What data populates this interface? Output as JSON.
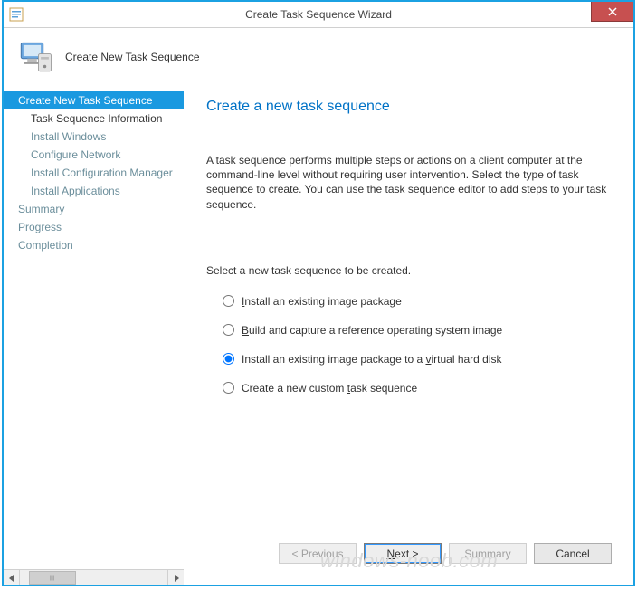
{
  "window": {
    "title": "Create Task Sequence Wizard",
    "close_icon_name": "close-icon"
  },
  "header": {
    "title": "Create New Task Sequence"
  },
  "nav": {
    "items": [
      {
        "label": "Create New Task Sequence",
        "selected": true,
        "indent": false
      },
      {
        "label": "Task Sequence Information",
        "selected": false,
        "indent": true,
        "active": true
      },
      {
        "label": "Install Windows",
        "selected": false,
        "indent": true
      },
      {
        "label": "Configure Network",
        "selected": false,
        "indent": true
      },
      {
        "label": "Install Configuration Manager",
        "selected": false,
        "indent": true
      },
      {
        "label": "Install Applications",
        "selected": false,
        "indent": true
      },
      {
        "label": "Summary",
        "selected": false,
        "indent": false
      },
      {
        "label": "Progress",
        "selected": false,
        "indent": false
      },
      {
        "label": "Completion",
        "selected": false,
        "indent": false
      }
    ]
  },
  "page": {
    "title": "Create a new task sequence",
    "description": "A task sequence performs multiple steps or actions on a client computer at the command-line level without requiring user intervention. Select the type of task sequence to create. You can use the task sequence editor to add steps to your task sequence.",
    "prompt": "Select a new task sequence to be created.",
    "options": {
      "opt1": {
        "pre": "",
        "u": "I",
        "post": "nstall an existing image package",
        "checked": false
      },
      "opt2": {
        "pre": "",
        "u": "B",
        "post": "uild and capture a reference operating system image",
        "checked": false
      },
      "opt3": {
        "pre": "Install an existing image package to a ",
        "u": "v",
        "post": "irtual hard disk",
        "checked": true
      },
      "opt4": {
        "pre": "Create a new custom ",
        "u": "t",
        "post": "ask sequence",
        "checked": false
      }
    }
  },
  "buttons": {
    "previous": "< Previous",
    "next": "Next >",
    "summary": "Summary",
    "cancel": "Cancel"
  },
  "watermark": "windows-noob.com"
}
